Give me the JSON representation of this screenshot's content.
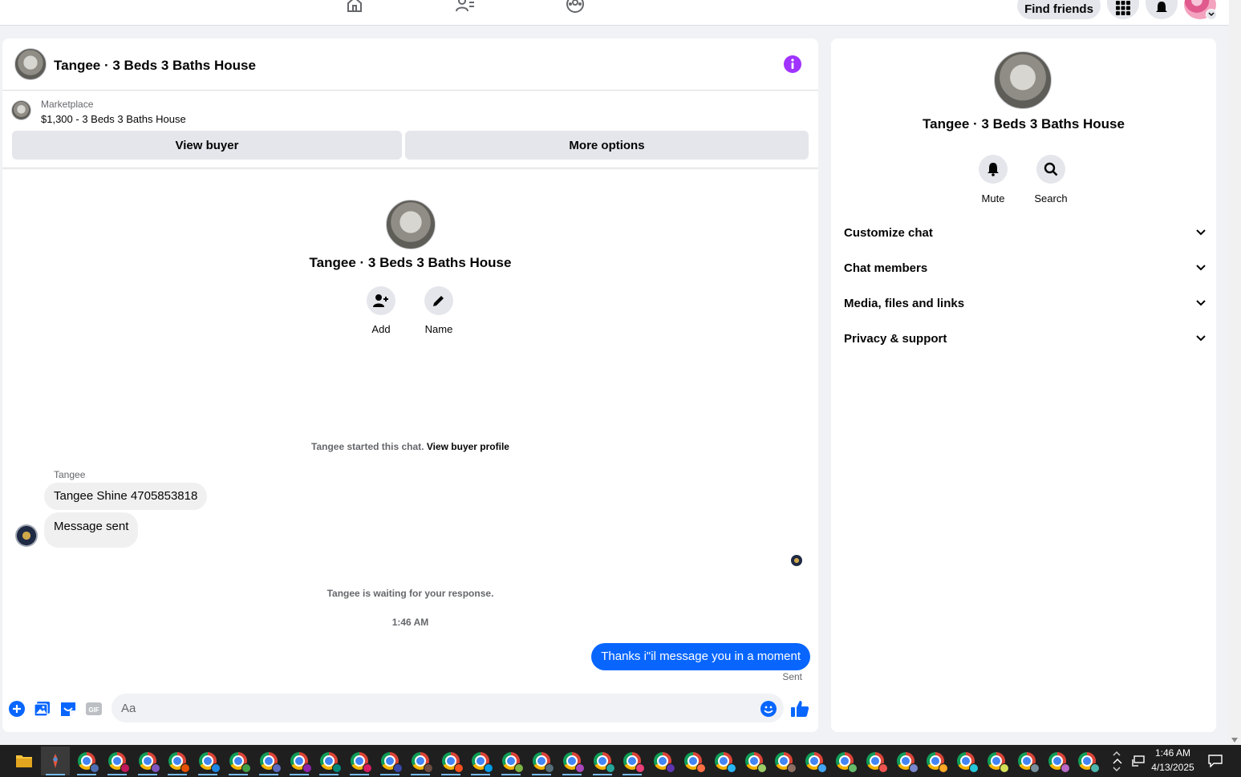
{
  "topbar": {
    "find_friends_label": "Find friends",
    "nav_icons": [
      "home-icon",
      "friends-icon",
      "groups-icon"
    ]
  },
  "chat": {
    "title": "Tangee · 3 Beds 3 Baths House",
    "marketplace_label": "Marketplace",
    "listing": "$1,300 - 3 Beds 3 Baths House",
    "view_buyer_label": "View buyer",
    "more_options_label": "More options",
    "intro_title": "Tangee · 3 Beds 3 Baths House",
    "add_label": "Add",
    "name_label": "Name",
    "started_text": "Tangee started this chat.",
    "view_buyer_profile": "View buyer profile",
    "sender_name": "Tangee",
    "messages_in": [
      "Tangee Shine 4705853818",
      "Message sent"
    ],
    "waiting_text": "Tangee is waiting for your response.",
    "timestamp": "1:46 AM",
    "message_out": "Thanks i\"il message you in a moment",
    "sent_status": "Sent",
    "composer_placeholder": "Aa",
    "accent_color": "#0866ff",
    "info_color": "#a033ff"
  },
  "details": {
    "title": "Tangee · 3 Beds 3 Baths House",
    "mute_label": "Mute",
    "search_label": "Search",
    "sections": [
      "Customize chat",
      "Chat members",
      "Media, files and links",
      "Privacy & support"
    ]
  },
  "taskbar": {
    "time": "1:46 AM",
    "date": "4/13/2025"
  }
}
